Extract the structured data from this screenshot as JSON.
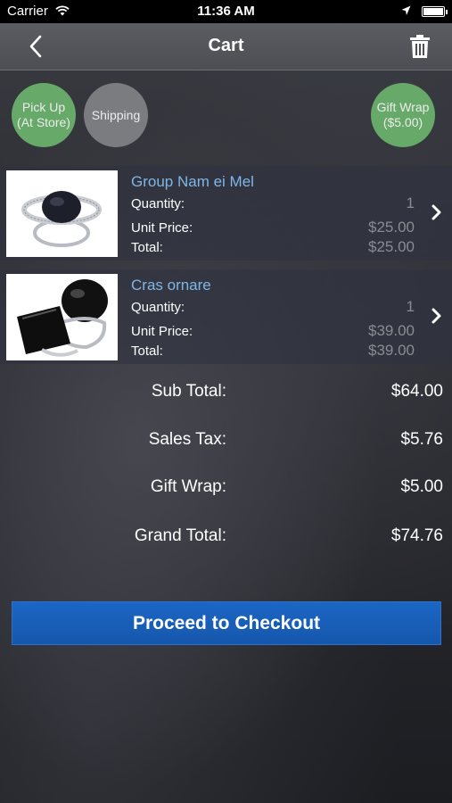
{
  "status_bar": {
    "carrier": "Carrier",
    "time": "11:36 AM",
    "icons": [
      "wifi-icon",
      "location-icon",
      "battery-icon"
    ]
  },
  "nav": {
    "title": "Cart",
    "back_icon": "chevron-left-icon",
    "delete_icon": "trash-icon"
  },
  "delivery_options": [
    {
      "label_line1": "Pick Up",
      "label_line2": "(At Store)",
      "color": "#67a968"
    },
    {
      "label_line1": "Shipping",
      "label_line2": "",
      "color": "#7a7c80"
    },
    {
      "label_line1": "Gift Wrap",
      "label_line2": "($5.00)",
      "color": "#67a968"
    }
  ],
  "cart": {
    "items": [
      {
        "name": "Group Nam ei Mel",
        "quantity_label": "Quantity:",
        "quantity": "1",
        "unit_price_label": "Unit Price:",
        "unit_price": "$25.00",
        "total_label": "Total:",
        "total": "$25.00"
      },
      {
        "name": "Cras ornare",
        "quantity_label": "Quantity:",
        "quantity": "1",
        "unit_price_label": "Unit Price:",
        "unit_price": "$39.00",
        "total_label": "Total:",
        "total": "$39.00"
      }
    ]
  },
  "summary": {
    "subtotal_label": "Sub Total:",
    "subtotal": "$64.00",
    "tax_label": "Sales Tax:",
    "tax": "$5.76",
    "giftwrap_label": "Gift Wrap:",
    "giftwrap": "$5.00",
    "grand_total_label": "Grand Total:",
    "grand_total": "$74.76"
  },
  "checkout": {
    "label": "Proceed to Checkout",
    "color": "#1b66c4"
  }
}
